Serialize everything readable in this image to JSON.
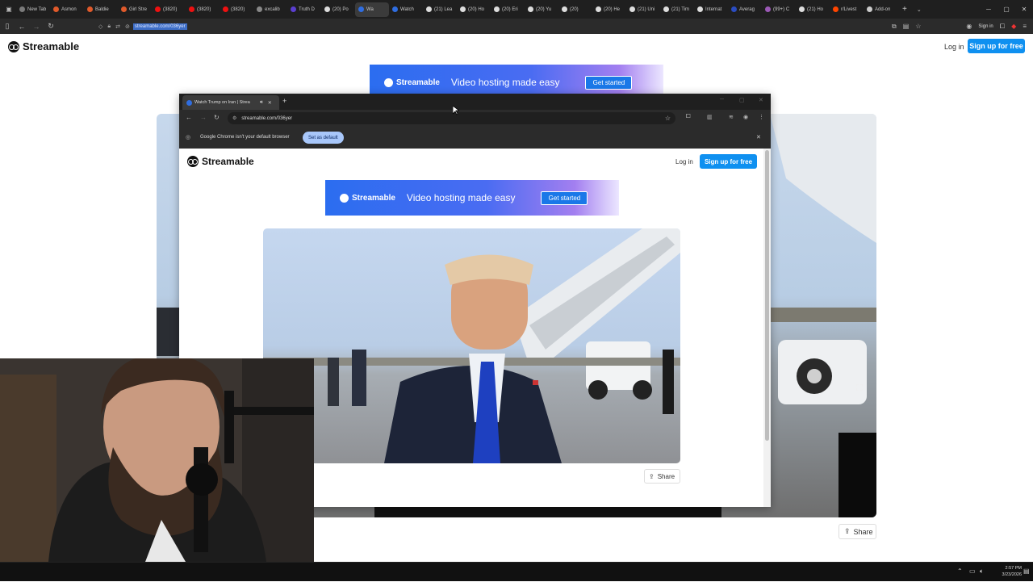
{
  "outer_browser": {
    "tabs": [
      {
        "label": "New Tab",
        "color": "#7a7a7a"
      },
      {
        "label": "Asmon",
        "color": "#e05a2b"
      },
      {
        "label": "Baldie",
        "color": "#e05a2b"
      },
      {
        "label": "Girl Stre",
        "color": "#e05a2b"
      },
      {
        "label": "(3820)",
        "color": "#e11"
      },
      {
        "label": "(3820)",
        "color": "#e11"
      },
      {
        "label": "(3820)",
        "color": "#e11"
      },
      {
        "label": "excalib",
        "color": "#888"
      },
      {
        "label": "Truth D",
        "color": "#5b3fd0"
      },
      {
        "label": "(20) Po",
        "color": "#ddd"
      },
      {
        "label": "Wa",
        "color": "#2f6de0"
      },
      {
        "label": "Watch",
        "color": "#2f6de0"
      },
      {
        "label": "(21) Lea",
        "color": "#ddd"
      },
      {
        "label": "(20) Ho",
        "color": "#ddd"
      },
      {
        "label": "(20) Eri",
        "color": "#ddd"
      },
      {
        "label": "(20) Yu",
        "color": "#ddd"
      },
      {
        "label": "(20)",
        "color": "#ddd"
      },
      {
        "label": "(20) He",
        "color": "#ddd"
      },
      {
        "label": "(21) Uni",
        "color": "#ddd"
      },
      {
        "label": "(21) Tim",
        "color": "#ddd"
      },
      {
        "label": "Internat",
        "color": "#ddd"
      },
      {
        "label": "Averag",
        "color": "#2b4cc0"
      },
      {
        "label": "(99+) C",
        "color": "#9b59b6"
      },
      {
        "label": "(21) Ho",
        "color": "#ddd"
      },
      {
        "label": "r/Livest",
        "color": "#ff4500"
      },
      {
        "label": "Add-on",
        "color": "#ccc"
      }
    ],
    "url": "streamable.com/036yer",
    "sign_in": "Sign in"
  },
  "outer_page": {
    "brand": "Streamable",
    "login": "Log in",
    "signup": "Sign up for free",
    "banner_brand": "Streamable",
    "banner_text": "Video hosting made easy",
    "banner_cta": "Get started",
    "share": "Share"
  },
  "inner_browser": {
    "tab_title": "Watch Trump on Iran | Strea",
    "url": "streamable.com/036yer",
    "infobar_text": "Google Chrome isn't your default browser",
    "infobar_button": "Set as default"
  },
  "inner_page": {
    "brand": "Streamable",
    "login": "Log in",
    "signup": "Sign up for free",
    "banner_brand": "Streamable",
    "banner_text": "Video hosting made easy",
    "banner_cta": "Get started",
    "share": "Share"
  },
  "taskbar": {
    "time": "2:57 PM",
    "date": "3/23/2026"
  }
}
